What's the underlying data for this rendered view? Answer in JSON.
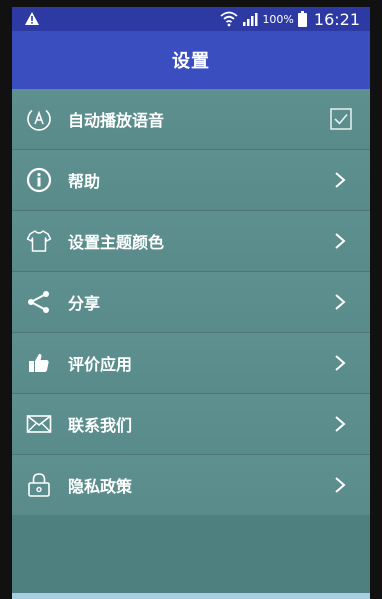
{
  "status_bar": {
    "battery_percent": "100%",
    "time": "16:21",
    "icons": [
      "warning-icon",
      "wifi-icon",
      "signal-icon",
      "battery-icon"
    ]
  },
  "app_bar": {
    "title": "设置"
  },
  "settings": {
    "items": [
      {
        "label": "自动播放语音",
        "icon": "auto-play-icon",
        "control": "checkbox",
        "checked": true
      },
      {
        "label": "帮助",
        "icon": "info-icon",
        "control": "chevron"
      },
      {
        "label": "设置主题颜色",
        "icon": "shirt-icon",
        "control": "chevron"
      },
      {
        "label": "分享",
        "icon": "share-icon",
        "control": "chevron"
      },
      {
        "label": "评价应用",
        "icon": "thumbs-up-icon",
        "control": "chevron"
      },
      {
        "label": "联系我们",
        "icon": "mail-icon",
        "control": "chevron"
      },
      {
        "label": "隐私政策",
        "icon": "lock-icon",
        "control": "chevron"
      }
    ]
  },
  "colors": {
    "status_bar": "#2d3aa3",
    "app_bar": "#3a4ec0",
    "list_background": "#5c8f8f"
  }
}
